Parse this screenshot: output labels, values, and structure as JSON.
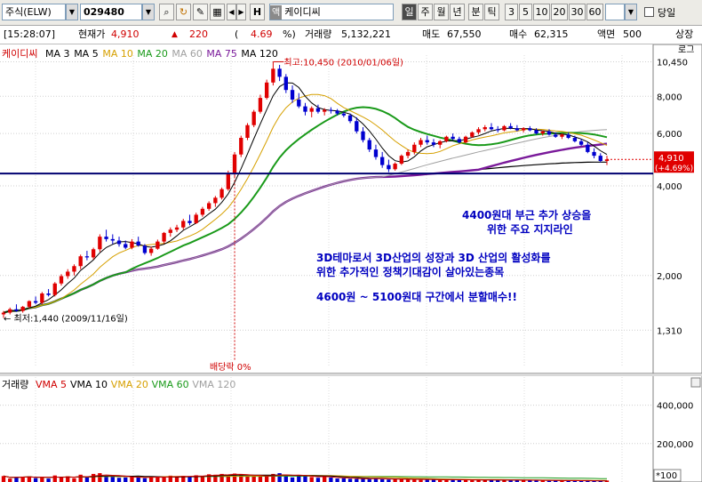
{
  "toolbar": {
    "market_type": "주식(ELW)",
    "code": "029480",
    "h_button": "H",
    "name_tag": "액",
    "name": "케이디씨",
    "periods": [
      "일",
      "주",
      "월",
      "년",
      "분",
      "틱"
    ],
    "intervals": [
      "3",
      "5",
      "10",
      "20",
      "30",
      "60"
    ],
    "same_day_label": "당일"
  },
  "info": {
    "time": "[15:28:07]",
    "price_label": "현재가",
    "price": "4,910",
    "change": "220",
    "change_pct": "4.69",
    "pct_unit": "%)",
    "volume_label": "거래량",
    "volume": "5,132,221",
    "ask_label": "매도",
    "ask": "67,550",
    "bid_label": "매수",
    "bid": "62,315",
    "par_label": "액면",
    "par": "500",
    "listing_label": "상장"
  },
  "chart_data": {
    "type": "candlestick",
    "price_legend": [
      {
        "label": "케이디씨",
        "color": "#d00000"
      },
      {
        "label": "MA 3",
        "color": "#000000"
      },
      {
        "label": "MA 5",
        "color": "#000000"
      },
      {
        "label": "MA 10",
        "color": "#d6a000"
      },
      {
        "label": "MA 20",
        "color": "#1a9a1a"
      },
      {
        "label": "MA 60",
        "color": "#a0a0a0"
      },
      {
        "label": "MA 75",
        "color": "#7a1a9a"
      },
      {
        "label": "MA 120",
        "color": "#000000"
      }
    ],
    "yscale": "log",
    "ylim": [
      1200,
      11000
    ],
    "y_ticks": [
      "10,450",
      "8,000",
      "6,000",
      "4,000",
      "2,000",
      "1,310"
    ],
    "y_tick_values": [
      10450,
      8000,
      6000,
      4000,
      2000,
      1310
    ],
    "axis_top_label": "로그",
    "current_price": "4,910",
    "current_change": "(+4.69%)",
    "high_annotation": "최고:10,450 (2010/01/06일)",
    "low_annotation": "최저:1,440 (2009/11/16일)",
    "dividend_label": "배당락 0%",
    "support_price": 4400,
    "support_note": [
      "4400원대 부근 추가 상승을",
      "위한 주요 지지라인"
    ],
    "note_lines": [
      "3D테마로서 3D산업의 성장과 3D 산업의 활성화를",
      "위한 추가적인 정책기대감이 살아있는종목"
    ],
    "buy_note": "4600원 ~ 5100원대 구간에서 분할매수!!",
    "candles": [
      [
        1480,
        1520,
        1440,
        1500
      ],
      [
        1500,
        1560,
        1480,
        1540
      ],
      [
        1540,
        1600,
        1510,
        1520
      ],
      [
        1520,
        1580,
        1500,
        1570
      ],
      [
        1570,
        1650,
        1550,
        1640
      ],
      [
        1640,
        1700,
        1600,
        1620
      ],
      [
        1620,
        1760,
        1600,
        1740
      ],
      [
        1740,
        1800,
        1700,
        1720
      ],
      [
        1720,
        1900,
        1700,
        1880
      ],
      [
        1880,
        2020,
        1850,
        1990
      ],
      [
        1990,
        2100,
        1950,
        2060
      ],
      [
        2060,
        2180,
        2000,
        2150
      ],
      [
        2150,
        2350,
        2100,
        2320
      ],
      [
        2320,
        2420,
        2250,
        2300
      ],
      [
        2300,
        2480,
        2260,
        2450
      ],
      [
        2450,
        2750,
        2400,
        2700
      ],
      [
        2700,
        2850,
        2600,
        2650
      ],
      [
        2650,
        2750,
        2550,
        2620
      ],
      [
        2620,
        2700,
        2500,
        2550
      ],
      [
        2550,
        2620,
        2450,
        2480
      ],
      [
        2480,
        2650,
        2450,
        2600
      ],
      [
        2600,
        2700,
        2500,
        2520
      ],
      [
        2520,
        2550,
        2350,
        2380
      ],
      [
        2380,
        2500,
        2330,
        2460
      ],
      [
        2460,
        2640,
        2440,
        2600
      ],
      [
        2600,
        2800,
        2560,
        2780
      ],
      [
        2780,
        2900,
        2700,
        2850
      ],
      [
        2850,
        2960,
        2800,
        2900
      ],
      [
        2900,
        3100,
        2850,
        3050
      ],
      [
        3050,
        3200,
        2950,
        3000
      ],
      [
        3000,
        3250,
        2980,
        3200
      ],
      [
        3200,
        3400,
        3150,
        3350
      ],
      [
        3350,
        3550,
        3300,
        3500
      ],
      [
        3500,
        3700,
        3400,
        3650
      ],
      [
        3650,
        3950,
        3600,
        3900
      ],
      [
        3900,
        4500,
        3850,
        4400
      ],
      [
        4400,
        5200,
        4300,
        5100
      ],
      [
        5100,
        5900,
        5000,
        5800
      ],
      [
        5800,
        6500,
        5700,
        6400
      ],
      [
        6400,
        7200,
        6300,
        7100
      ],
      [
        7100,
        8100,
        7000,
        7900
      ],
      [
        7900,
        9100,
        7800,
        8900
      ],
      [
        8900,
        10450,
        8700,
        9900
      ],
      [
        9900,
        10200,
        9000,
        9300
      ],
      [
        9300,
        9500,
        8200,
        8400
      ],
      [
        8400,
        8700,
        7600,
        7800
      ],
      [
        7800,
        8200,
        7300,
        7400
      ],
      [
        7400,
        7600,
        6900,
        7100
      ],
      [
        7100,
        7400,
        6800,
        7300
      ],
      [
        7300,
        7500,
        7000,
        7100
      ],
      [
        7100,
        7300,
        6900,
        7200
      ],
      [
        7200,
        7350,
        7000,
        7150
      ],
      [
        7150,
        7250,
        6900,
        7000
      ],
      [
        7000,
        7100,
        6800,
        6900
      ],
      [
        6900,
        7000,
        6500,
        6600
      ],
      [
        6600,
        6800,
        6000,
        6100
      ],
      [
        6100,
        6300,
        5600,
        5700
      ],
      [
        5700,
        5800,
        5200,
        5300
      ],
      [
        5300,
        5500,
        4900,
        5000
      ],
      [
        5000,
        5200,
        4600,
        4700
      ],
      [
        4700,
        4900,
        4450,
        4550
      ],
      [
        4550,
        4800,
        4500,
        4750
      ],
      [
        4750,
        5100,
        4700,
        5050
      ],
      [
        5050,
        5300,
        4950,
        5200
      ],
      [
        5200,
        5600,
        5100,
        5500
      ],
      [
        5500,
        5800,
        5400,
        5700
      ],
      [
        5700,
        5900,
        5500,
        5600
      ],
      [
        5600,
        5750,
        5400,
        5500
      ],
      [
        5500,
        5700,
        5350,
        5650
      ],
      [
        5650,
        5900,
        5600,
        5850
      ],
      [
        5850,
        6000,
        5700,
        5750
      ],
      [
        5750,
        5850,
        5550,
        5600
      ],
      [
        5600,
        5900,
        5550,
        5850
      ],
      [
        5850,
        6100,
        5800,
        6050
      ],
      [
        6050,
        6300,
        5950,
        6200
      ],
      [
        6200,
        6400,
        6100,
        6300
      ],
      [
        6300,
        6500,
        6150,
        6200
      ],
      [
        6200,
        6350,
        6050,
        6150
      ],
      [
        6150,
        6400,
        6100,
        6350
      ],
      [
        6350,
        6500,
        6200,
        6250
      ],
      [
        6250,
        6400,
        6100,
        6150
      ],
      [
        6150,
        6300,
        6050,
        6250
      ],
      [
        6250,
        6350,
        6100,
        6150
      ],
      [
        6150,
        6250,
        5950,
        6000
      ],
      [
        6000,
        6150,
        5900,
        6100
      ],
      [
        6100,
        6200,
        5900,
        5950
      ],
      [
        5950,
        6050,
        5800,
        5850
      ],
      [
        5850,
        6000,
        5750,
        5950
      ],
      [
        5950,
        6050,
        5750,
        5800
      ],
      [
        5800,
        5900,
        5600,
        5650
      ],
      [
        5650,
        5750,
        5450,
        5500
      ],
      [
        5500,
        5600,
        5150,
        5200
      ],
      [
        5200,
        5350,
        4950,
        5050
      ],
      [
        5050,
        5150,
        4800,
        4850
      ],
      [
        4850,
        5050,
        4700,
        4910
      ]
    ],
    "volume_legend": [
      {
        "label": "거래량",
        "color": "#000000"
      },
      {
        "label": "VMA 5",
        "color": "#d00000"
      },
      {
        "label": "VMA 10",
        "color": "#000000"
      },
      {
        "label": "VMA 20",
        "color": "#d6a000"
      },
      {
        "label": "VMA 60",
        "color": "#1a9a1a"
      },
      {
        "label": "VMA 120",
        "color": "#a0a0a0"
      }
    ],
    "volume_ticks": [
      "400,000",
      "200,000"
    ],
    "volume_tick_values": [
      400000,
      200000
    ],
    "volume_ylim": [
      0,
      500000
    ],
    "volume_unit": "*100",
    "volume": [
      310,
      180,
      240,
      280,
      300,
      200,
      260,
      180,
      340,
      240,
      300,
      200,
      380,
      250,
      420,
      460,
      320,
      280,
      220,
      240,
      260,
      250,
      200,
      270,
      300,
      230,
      330,
      260,
      320,
      290,
      350,
      310,
      400,
      380,
      420,
      360,
      440,
      390,
      280,
      300,
      330,
      280,
      420,
      460,
      370,
      240,
      300,
      350,
      260,
      220,
      280,
      230,
      180,
      200,
      170,
      160,
      180,
      150,
      200,
      140,
      130,
      150,
      160,
      120,
      140,
      110,
      130,
      120,
      100,
      110,
      140,
      100,
      120,
      90,
      110,
      100,
      120,
      90,
      100,
      80,
      100,
      90,
      110,
      70,
      80,
      60,
      80,
      70,
      60,
      80,
      50,
      70,
      60,
      50,
      80
    ]
  }
}
